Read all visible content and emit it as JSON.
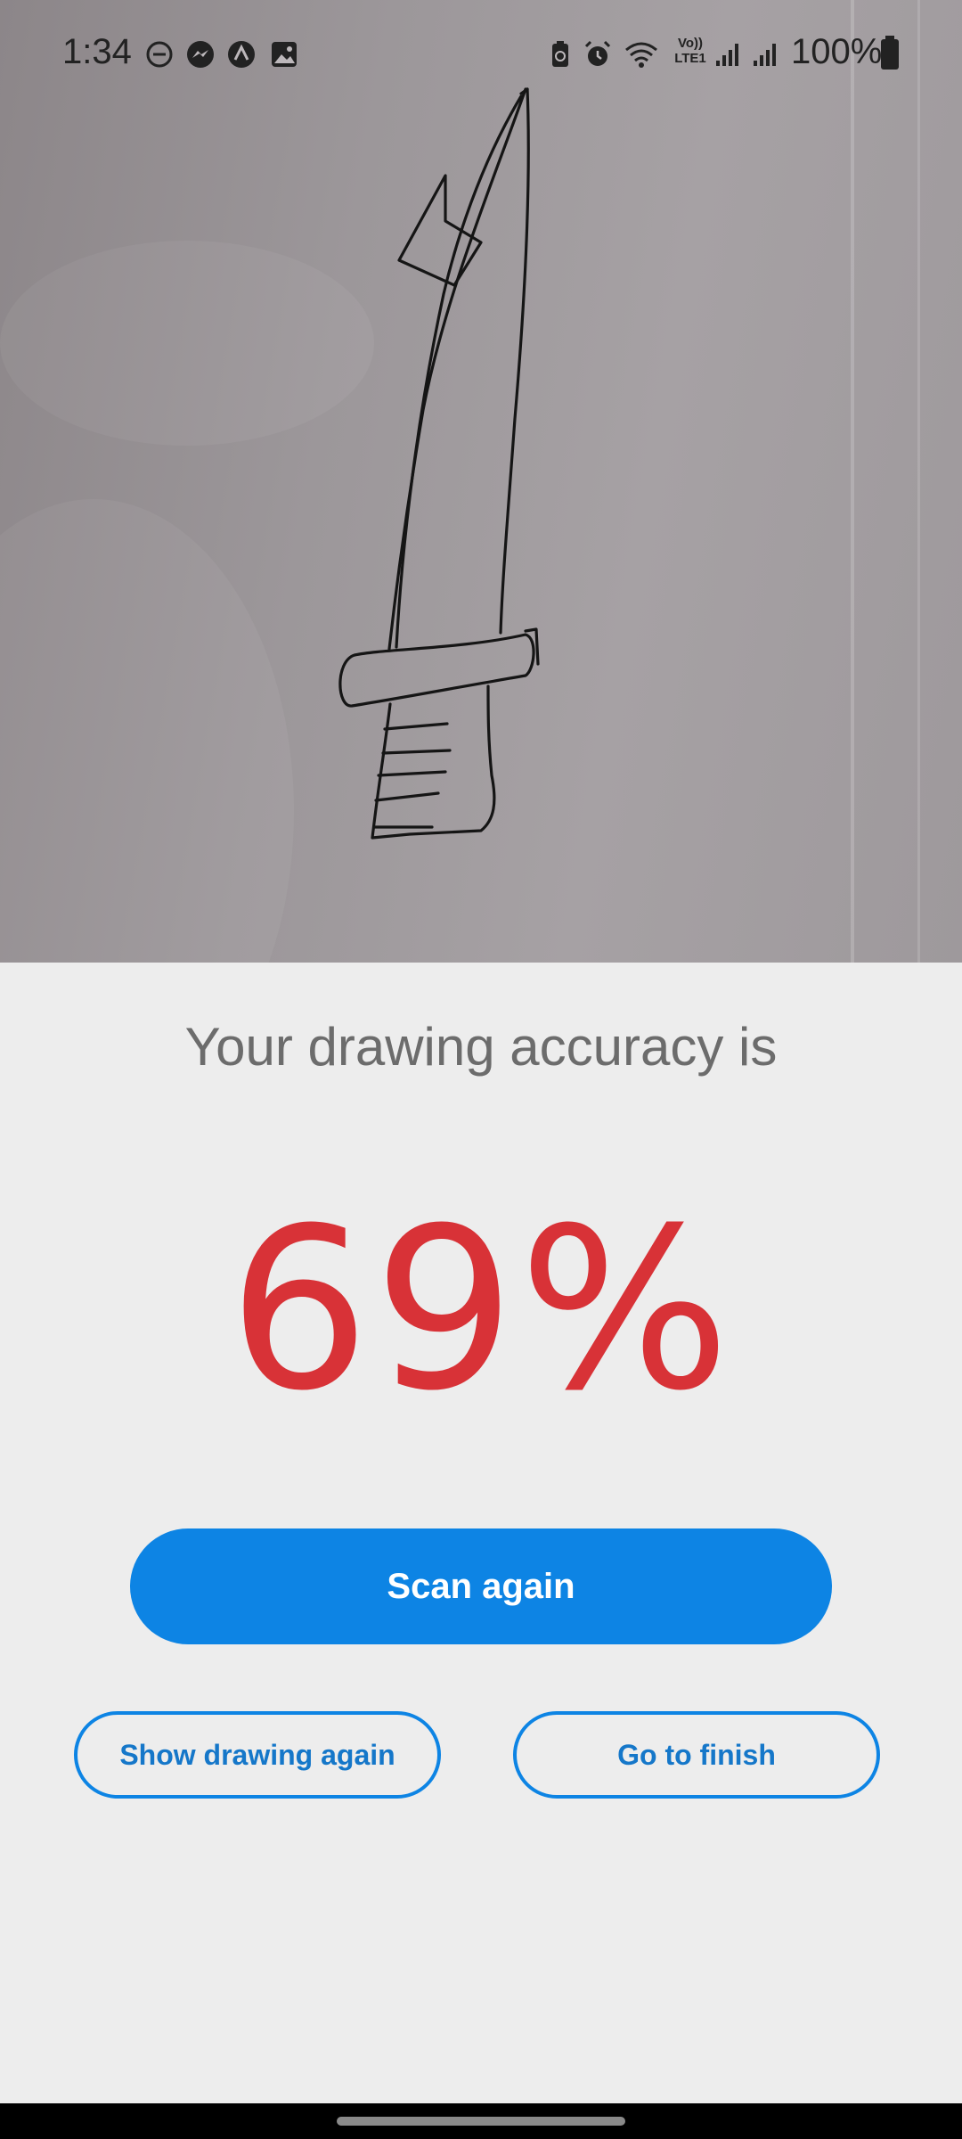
{
  "status_bar": {
    "time": "1:34",
    "battery_percent": "100%",
    "left_icons": [
      "do-not-disturb-icon",
      "messenger-icon",
      "app-icon",
      "gallery-icon"
    ],
    "right_icons": [
      "battery-saver-icon",
      "alarm-icon",
      "wifi-icon",
      "volte-icon",
      "signal-icon",
      "signal-icon",
      "battery-icon"
    ],
    "volte_label_top": "Vo))",
    "volte_label_bottom": "LTE1"
  },
  "result": {
    "heading": "Your drawing accuracy is",
    "accuracy": "69%",
    "accuracy_color": "#d83237"
  },
  "actions": {
    "scan_again": "Scan again",
    "show_drawing_again": "Show drawing again",
    "go_to_finish": "Go to finish",
    "accent_color": "#0d84e4"
  }
}
